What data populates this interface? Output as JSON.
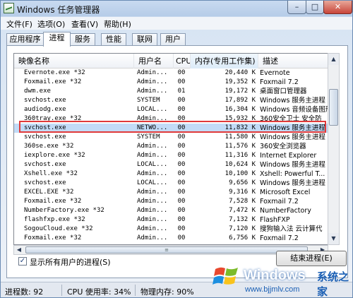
{
  "window": {
    "title": "Windows 任务管理器",
    "min_label": "–",
    "max_label": "□",
    "close_label": "✕"
  },
  "menu": [
    "文件(F)",
    "选项(O)",
    "查看(V)",
    "帮助(H)"
  ],
  "tabs": [
    "应用程序",
    "进程",
    "服务",
    "性能",
    "联网",
    "用户"
  ],
  "active_tab": "进程",
  "columns": [
    "映像名称",
    "用户名",
    "CPU",
    "内存(专用工作集)",
    "描述"
  ],
  "rows": [
    {
      "name": "Evernote.exe *32",
      "user": "Admin...",
      "cpu": "00",
      "mem": "20,440 K",
      "desc": "Evernote"
    },
    {
      "name": "Foxmail.exe *32",
      "user": "Admin...",
      "cpu": "00",
      "mem": "19,352 K",
      "desc": "Foxmail 7.2"
    },
    {
      "name": "dwm.exe",
      "user": "Admin...",
      "cpu": "01",
      "mem": "19,172 K",
      "desc": "桌面窗口管理器"
    },
    {
      "name": "svchost.exe",
      "user": "SYSTEM",
      "cpu": "00",
      "mem": "17,892 K",
      "desc": "Windows 服务主进程"
    },
    {
      "name": "audiodg.exe",
      "user": "LOCAL...",
      "cpu": "00",
      "mem": "16,304 K",
      "desc": "Windows 音频设备图形"
    },
    {
      "name": "360tray.exe *32",
      "user": "Admin...",
      "cpu": "00",
      "mem": "15,932 K",
      "desc": "360安全卫士 安全防"
    },
    {
      "name": "svchost.exe",
      "user": "NETWO...",
      "cpu": "00",
      "mem": "11,832 K",
      "desc": "Windows 服务主进程"
    },
    {
      "name": "svchost.exe",
      "user": "SYSTEM",
      "cpu": "00",
      "mem": "11,580 K",
      "desc": "Windows 服务主进程"
    },
    {
      "name": "360se.exe *32",
      "user": "Admin...",
      "cpu": "00",
      "mem": "11,576 K",
      "desc": "360安全浏览器"
    },
    {
      "name": "iexplore.exe *32",
      "user": "Admin...",
      "cpu": "00",
      "mem": "11,316 K",
      "desc": "Internet Explorer"
    },
    {
      "name": "svchost.exe",
      "user": "LOCAL...",
      "cpu": "00",
      "mem": "10,624 K",
      "desc": "Windows 服务主进程"
    },
    {
      "name": "Xshell.exe *32",
      "user": "Admin...",
      "cpu": "00",
      "mem": "10,100 K",
      "desc": "Xshell: Powerful T..."
    },
    {
      "name": "svchost.exe",
      "user": "LOCAL...",
      "cpu": "00",
      "mem": "9,656 K",
      "desc": "Windows 服务主进程"
    },
    {
      "name": "EXCEL.EXE *32",
      "user": "Admin...",
      "cpu": "00",
      "mem": "9,316 K",
      "desc": "Microsoft Excel"
    },
    {
      "name": "Foxmail.exe *32",
      "user": "Admin...",
      "cpu": "00",
      "mem": "7,528 K",
      "desc": "Foxmail 7.2"
    },
    {
      "name": "NumberFactory.exe *32",
      "user": "Admin...",
      "cpu": "00",
      "mem": "7,472 K",
      "desc": "NumberFactory"
    },
    {
      "name": "flashfxp.exe *32",
      "user": "Admin...",
      "cpu": "00",
      "mem": "7,132 K",
      "desc": "FlashFXP"
    },
    {
      "name": "SogouCloud.exe *32",
      "user": "Admin...",
      "cpu": "00",
      "mem": "7,120 K",
      "desc": "搜狗输入法 云计算代"
    },
    {
      "name": "Foxmail.exe *32",
      "user": "Admin...",
      "cpu": "00",
      "mem": "6,756 K",
      "desc": "Foxmail 7.2"
    }
  ],
  "selected_row_index": 6,
  "show_all_label": "显示所有用户的进程(S)",
  "show_all_checked": true,
  "end_process_label": "结束进程(E)",
  "status": {
    "processes": "进程数: 92",
    "cpu": "CPU 使用率: 34%",
    "memory": "物理内存: 90%"
  },
  "watermark": {
    "brand": "Windows",
    "suffix": "系统之家",
    "url": "www.bjjmlv.com"
  }
}
